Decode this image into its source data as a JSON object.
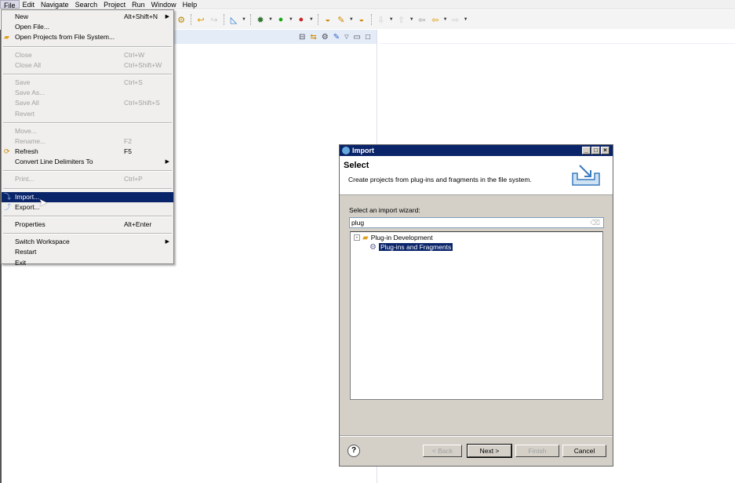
{
  "menubar": [
    "File",
    "Edit",
    "Navigate",
    "Search",
    "Project",
    "Run",
    "Window",
    "Help"
  ],
  "file_menu": [
    {
      "label": "New",
      "accel": "Alt+Shift+N",
      "submenu": true
    },
    {
      "label": "Open File..."
    },
    {
      "label": "Open Projects from File System...",
      "icon": "folder-icon"
    },
    {
      "sep": true
    },
    {
      "label": "Close",
      "accel": "Ctrl+W",
      "disabled": true
    },
    {
      "label": "Close All",
      "accel": "Ctrl+Shift+W",
      "disabled": true
    },
    {
      "sep": true
    },
    {
      "label": "Save",
      "accel": "Ctrl+S",
      "disabled": true
    },
    {
      "label": "Save As...",
      "disabled": true
    },
    {
      "label": "Save All",
      "accel": "Ctrl+Shift+S",
      "disabled": true
    },
    {
      "label": "Revert",
      "disabled": true
    },
    {
      "sep": true
    },
    {
      "label": "Move...",
      "disabled": true
    },
    {
      "label": "Rename...",
      "accel": "F2",
      "disabled": true
    },
    {
      "label": "Refresh",
      "accel": "F5",
      "icon": "refresh-icon"
    },
    {
      "label": "Convert Line Delimiters To",
      "submenu": true
    },
    {
      "sep": true
    },
    {
      "label": "Print...",
      "accel": "Ctrl+P",
      "disabled": true
    },
    {
      "sep": true
    },
    {
      "label": "Import...",
      "icon": "import-icon",
      "selected": true
    },
    {
      "label": "Export...",
      "icon": "export-icon"
    },
    {
      "sep": true
    },
    {
      "label": "Properties",
      "accel": "Alt+Enter"
    },
    {
      "sep": true
    },
    {
      "label": "Switch Workspace",
      "submenu": true
    },
    {
      "label": "Restart"
    },
    {
      "label": "Exit"
    }
  ],
  "dialog": {
    "title": "Import",
    "heading": "Select",
    "description": "Create projects from plug-ins and fragments in the file system.",
    "filter_label": "Select an import wizard:",
    "filter_value": "plug",
    "tree": {
      "category": "Plug-in Development",
      "item": "Plug-ins and Fragments"
    },
    "buttons": {
      "back": "< Back",
      "next": "Next >",
      "finish": "Finish",
      "cancel": "Cancel"
    }
  },
  "colors": {
    "selection": "#0a246a",
    "dialog_bg": "#d4d0c8"
  }
}
